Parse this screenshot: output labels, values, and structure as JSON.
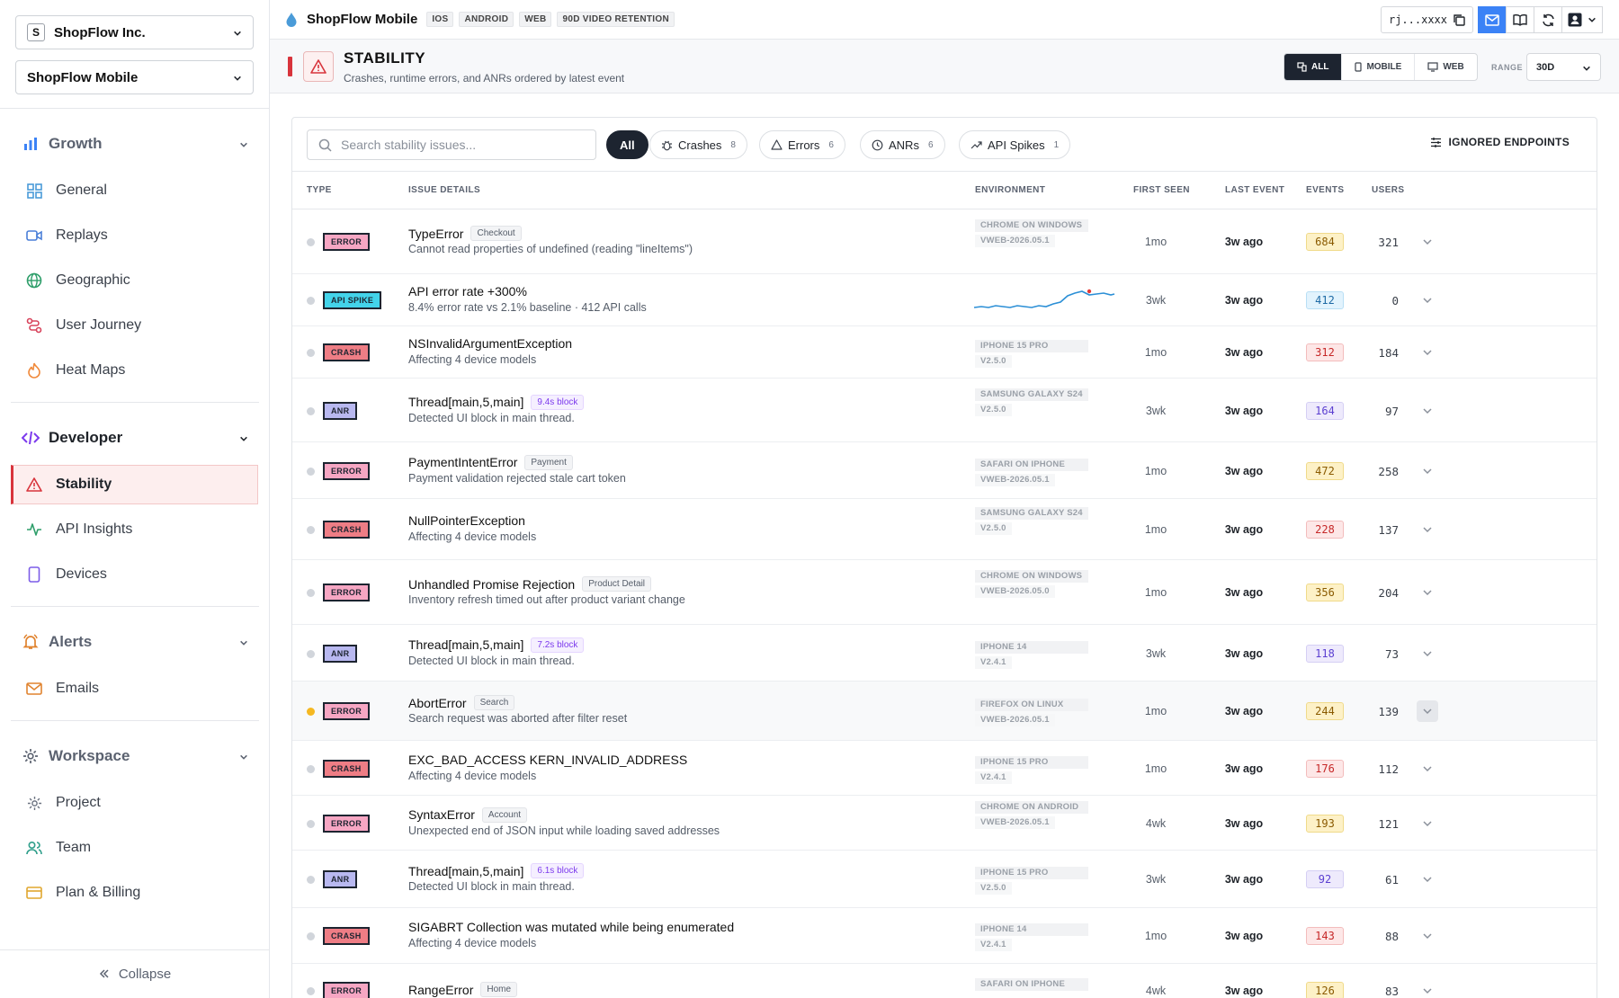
{
  "org": {
    "badge": "S",
    "name": "ShopFlow Inc."
  },
  "project": {
    "name": "ShopFlow Mobile"
  },
  "nav": {
    "growth": {
      "label": "Growth",
      "items": [
        {
          "label": "General",
          "icon": "grid-icon"
        },
        {
          "label": "Replays",
          "icon": "video-icon"
        },
        {
          "label": "Geographic",
          "icon": "globe-icon"
        },
        {
          "label": "User Journey",
          "icon": "route-icon"
        },
        {
          "label": "Heat Maps",
          "icon": "flame-icon"
        }
      ]
    },
    "developer": {
      "label": "Developer",
      "items": [
        {
          "label": "Stability",
          "icon": "warning-icon"
        },
        {
          "label": "API Insights",
          "icon": "pulse-icon"
        },
        {
          "label": "Devices",
          "icon": "phone-icon"
        }
      ]
    },
    "alerts": {
      "label": "Alerts",
      "items": [
        {
          "label": "Emails",
          "icon": "mail-icon"
        }
      ]
    },
    "workspace": {
      "label": "Workspace",
      "items": [
        {
          "label": "Project",
          "icon": "gear-icon"
        },
        {
          "label": "Team",
          "icon": "users-icon"
        },
        {
          "label": "Plan & Billing",
          "icon": "card-icon"
        }
      ]
    },
    "collapse": "Collapse"
  },
  "topbar": {
    "app_title": "ShopFlow Mobile",
    "tags": [
      "IOS",
      "ANDROID",
      "WEB",
      "90D VIDEO RETENTION"
    ],
    "key": "rj...xxxx"
  },
  "header": {
    "title": "STABILITY",
    "subtitle": "Crashes, runtime errors, and ANRs ordered by latest event",
    "platforms": [
      "ALL",
      "MOBILE",
      "WEB"
    ],
    "range_label": "RANGE",
    "range_value": "30D"
  },
  "filters": {
    "search_placeholder": "Search stability issues...",
    "all": "All",
    "chips": [
      {
        "label": "Crashes",
        "count": "8"
      },
      {
        "label": "Errors",
        "count": "6"
      },
      {
        "label": "ANRs",
        "count": "6"
      },
      {
        "label": "API Spikes",
        "count": "1"
      }
    ],
    "ignored": "IGNORED ENDPOINTS"
  },
  "columns": {
    "type": "TYPE",
    "details": "ISSUE DETAILS",
    "env": "ENVIRONMENT",
    "first": "FIRST SEEN",
    "last": "LAST EVENT",
    "events": "EVENTS",
    "users": "USERS"
  },
  "rows": [
    {
      "type": "ERROR",
      "kind": "error",
      "name": "TypeError",
      "tag": "Checkout",
      "desc": "Cannot read properties of undefined (reading \"lineItems\")",
      "env": "CHROME ON WINDOWS",
      "ver": "VWEB-2026.05.1",
      "first": "1mo",
      "last": "3w ago",
      "events": "684",
      "users": "321"
    },
    {
      "type": "API SPIKE",
      "kind": "api",
      "name": "API error rate +300%",
      "tag": "",
      "desc": "8.4% error rate vs 2.1% baseline · 412 API calls",
      "env": "",
      "ver": "",
      "first": "3wk",
      "last": "3w ago",
      "events": "412",
      "users": "0"
    },
    {
      "type": "CRASH",
      "kind": "crash",
      "name": "NSInvalidArgumentException",
      "tag": "",
      "desc": "Affecting 4 device models",
      "env": "IPHONE 15 PRO",
      "ver": "V2.5.0",
      "first": "1mo",
      "last": "3w ago",
      "events": "312",
      "users": "184"
    },
    {
      "type": "ANR",
      "kind": "anr",
      "name": "Thread[main,5,main]",
      "tag": "9.4s block",
      "desc": "Detected UI block in main thread.",
      "env": "SAMSUNG GALAXY S24",
      "ver": "V2.5.0",
      "first": "3wk",
      "last": "3w ago",
      "events": "164",
      "users": "97"
    },
    {
      "type": "ERROR",
      "kind": "error",
      "name": "PaymentIntentError",
      "tag": "Payment",
      "desc": "Payment validation rejected stale cart token",
      "env": "SAFARI ON IPHONE",
      "ver": "VWEB-2026.05.1",
      "first": "1mo",
      "last": "3w ago",
      "events": "472",
      "users": "258"
    },
    {
      "type": "CRASH",
      "kind": "crash",
      "name": "NullPointerException",
      "tag": "",
      "desc": "Affecting 4 device models",
      "env": "SAMSUNG GALAXY S24",
      "ver": "V2.5.0",
      "first": "1mo",
      "last": "3w ago",
      "events": "228",
      "users": "137"
    },
    {
      "type": "ERROR",
      "kind": "error",
      "name": "Unhandled Promise Rejection",
      "tag": "Product Detail",
      "desc": "Inventory refresh timed out after product variant change",
      "env": "CHROME ON WINDOWS",
      "ver": "VWEB-2026.05.0",
      "first": "1mo",
      "last": "3w ago",
      "events": "356",
      "users": "204"
    },
    {
      "type": "ANR",
      "kind": "anr",
      "name": "Thread[main,5,main]",
      "tag": "7.2s block",
      "desc": "Detected UI block in main thread.",
      "env": "IPHONE 14",
      "ver": "V2.4.1",
      "first": "3wk",
      "last": "3w ago",
      "events": "118",
      "users": "73"
    },
    {
      "type": "ERROR",
      "kind": "error",
      "name": "AbortError",
      "tag": "Search",
      "desc": "Search request was aborted after filter reset",
      "env": "FIREFOX ON LINUX",
      "ver": "VWEB-2026.05.1",
      "first": "1mo",
      "last": "3w ago",
      "events": "244",
      "users": "139"
    },
    {
      "type": "CRASH",
      "kind": "crash",
      "name": "EXC_BAD_ACCESS KERN_INVALID_ADDRESS",
      "tag": "",
      "desc": "Affecting 4 device models",
      "env": "IPHONE 15 PRO",
      "ver": "V2.4.1",
      "first": "1mo",
      "last": "3w ago",
      "events": "176",
      "users": "112"
    },
    {
      "type": "ERROR",
      "kind": "error",
      "name": "SyntaxError",
      "tag": "Account",
      "desc": "Unexpected end of JSON input while loading saved addresses",
      "env": "CHROME ON ANDROID",
      "ver": "VWEB-2026.05.1",
      "first": "4wk",
      "last": "3w ago",
      "events": "193",
      "users": "121"
    },
    {
      "type": "ANR",
      "kind": "anr",
      "name": "Thread[main,5,main]",
      "tag": "6.1s block",
      "desc": "Detected UI block in main thread.",
      "env": "IPHONE 15 PRO",
      "ver": "V2.5.0",
      "first": "3wk",
      "last": "3w ago",
      "events": "92",
      "users": "61"
    },
    {
      "type": "CRASH",
      "kind": "crash",
      "name": "SIGABRT Collection was mutated while being enumerated",
      "tag": "",
      "desc": "Affecting 4 device models",
      "env": "IPHONE 14",
      "ver": "V2.4.1",
      "first": "1mo",
      "last": "3w ago",
      "events": "143",
      "users": "88"
    },
    {
      "type": "ERROR",
      "kind": "error",
      "name": "RangeError",
      "tag": "Home",
      "desc": "",
      "env": "SAFARI ON IPHONE",
      "ver": "",
      "first": "4wk",
      "last": "3w ago",
      "events": "126",
      "users": "83"
    }
  ]
}
